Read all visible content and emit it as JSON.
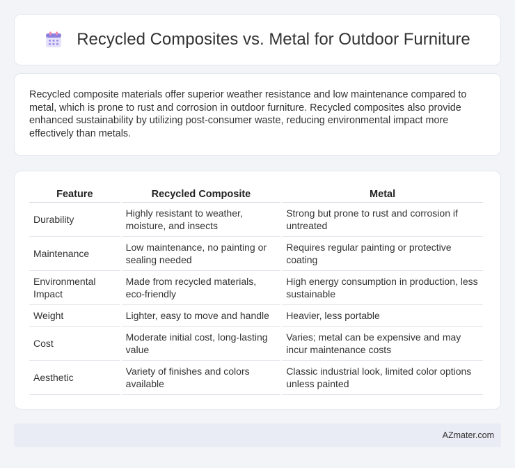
{
  "header": {
    "title": "Recycled Composites vs. Metal for Outdoor Furniture",
    "icon": "calendar-icon"
  },
  "summary": {
    "text": "Recycled composite materials offer superior weather resistance and low maintenance compared to metal, which is prone to rust and corrosion in outdoor furniture. Recycled composites also provide enhanced sustainability by utilizing post-consumer waste, reducing environmental impact more effectively than metals."
  },
  "table": {
    "headers": [
      "Feature",
      "Recycled Composite",
      "Metal"
    ],
    "rows": [
      [
        "Durability",
        "Highly resistant to weather, moisture, and insects",
        "Strong but prone to rust and corrosion if untreated"
      ],
      [
        "Maintenance",
        "Low maintenance, no painting or sealing needed",
        "Requires regular painting or protective coating"
      ],
      [
        "Environmental Impact",
        "Made from recycled materials, eco-friendly",
        "High energy consumption in production, less sustainable"
      ],
      [
        "Weight",
        "Lighter, easy to move and handle",
        "Heavier, less portable"
      ],
      [
        "Cost",
        "Moderate initial cost, long-lasting value",
        "Varies; metal can be expensive and may incur maintenance costs"
      ],
      [
        "Aesthetic",
        "Variety of finishes and colors available",
        "Classic industrial look, limited color options unless painted"
      ]
    ]
  },
  "footer": {
    "text": "AZmater.com"
  },
  "colors": {
    "background": "#f3f4f8",
    "card": "#ffffff",
    "footer": "#e9ecf5",
    "icon_purple": "#8b7fe0",
    "icon_pink": "#f08ab0"
  }
}
